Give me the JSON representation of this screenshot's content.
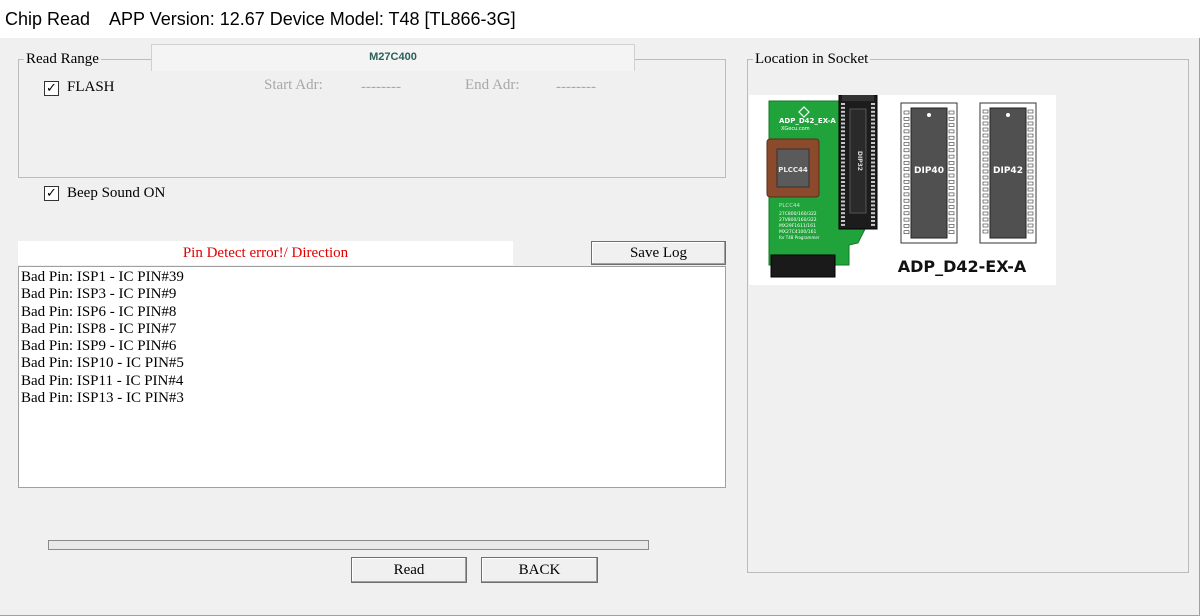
{
  "title": {
    "window_name": "Chip Read",
    "info": "APP Version: 12.67 Device Model: T48 [TL866-3G]"
  },
  "read_range": {
    "legend": "Read Range",
    "chip_name": "M27C400",
    "flash_label": "FLASH",
    "flash_checked": true,
    "start_label": "Start Adr:",
    "start_value": "--------",
    "end_label": "End Adr:",
    "end_value": "--------"
  },
  "beep": {
    "label": "Beep Sound ON",
    "checked": true
  },
  "status_text": "Pin Detect error!/ Direction",
  "save_log_label": "Save Log",
  "log_lines": [
    "Bad Pin: ISP1 - IC PIN#39",
    "Bad Pin: ISP3 - IC PIN#9",
    "Bad Pin: ISP6 - IC PIN#8",
    "Bad Pin: ISP8 - IC PIN#7",
    "Bad Pin: ISP9 - IC PIN#6",
    "Bad Pin: ISP10 - IC PIN#5",
    "Bad Pin: ISP11 - IC PIN#4",
    "Bad Pin: ISP13 - IC PIN#3"
  ],
  "progress": 0,
  "buttons": {
    "read": "Read",
    "back": "BACK"
  },
  "socket": {
    "legend": "Location in Socket",
    "adapter_name": "ADP_D42-EX-A",
    "board_label": "ADP_D42_EX-A",
    "board_sublabel": "XGecu.com",
    "plcc_label": "PLCC44",
    "dip32_label": "DIP32",
    "dip40_label": "DIP40",
    "dip42_label": "DIP42",
    "board_text_lines": [
      "27C800/160/322",
      "27V800/160/322",
      "MX29F1611/161",
      "MX27C4100/161",
      "for T48 Programmer"
    ]
  },
  "colors": {
    "status_error": "#e00000",
    "chip_name": "#2c5f5a",
    "pcb_green": "#1fa33a",
    "plcc_brown": "#8b4a2b",
    "progress_fill": "#06b025"
  }
}
